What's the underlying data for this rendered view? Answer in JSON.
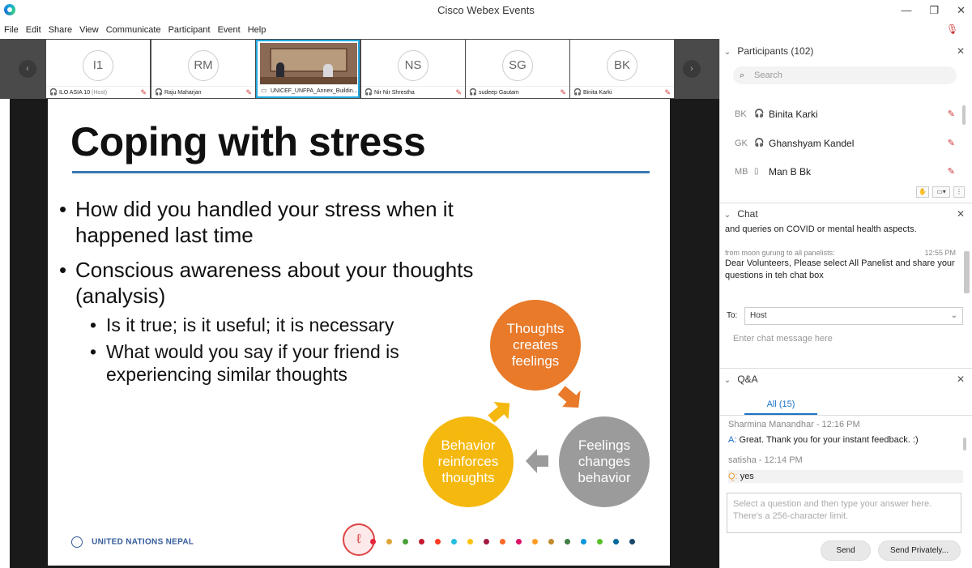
{
  "window": {
    "title": "Cisco Webex Events",
    "minimize": "—",
    "maximize": "❐",
    "close": "✕"
  },
  "menu": {
    "items": [
      "File",
      "Edit",
      "Share",
      "View",
      "Communicate",
      "Participant",
      "Event",
      "Help"
    ]
  },
  "strip": {
    "prev": "‹",
    "next": "›",
    "thumbs": [
      {
        "initials": "I1",
        "name": "ILO ASIA 10",
        "role": "(Host)"
      },
      {
        "initials": "RM",
        "name": "Raju Maharjan"
      },
      {
        "initials": "",
        "name": "UNICEF_UNFPA_Annex_Buildin..."
      },
      {
        "initials": "NS",
        "name": "Nir Nir Shrestha"
      },
      {
        "initials": "SG",
        "name": "sudeep Gautam"
      },
      {
        "initials": "BK",
        "name": "Binita Karki"
      }
    ]
  },
  "slide": {
    "title": "Coping with stress",
    "bullets": [
      {
        "lines": [
          "How did you handled your stress when it",
          "happened last time"
        ]
      },
      {
        "lines": [
          "Conscious awareness about your thoughts",
          "(analysis)"
        ]
      }
    ],
    "subbullets": [
      {
        "lines": [
          "Is it true; is it useful; it is necessary"
        ]
      },
      {
        "lines": [
          "What would you say if your friend is",
          "experiencing similar thoughts"
        ]
      }
    ],
    "cycle": {
      "thoughts": [
        "Thoughts",
        "creates",
        "feelings"
      ],
      "feelings": [
        "Feelings",
        "changes",
        "behavior"
      ],
      "behavior": [
        "Behavior",
        "reinforces",
        "thoughts"
      ]
    },
    "footer": "UNITED NATIONS NEPAL",
    "dot_colors": [
      "#e5243b",
      "#dda63a",
      "#4c9f38",
      "#c5192d",
      "#ff3a21",
      "#26bde2",
      "#fcc30b",
      "#a21942",
      "#fd6925",
      "#dd1367",
      "#fd9d24",
      "#bf8b2e",
      "#3f7e44",
      "#0a97d9",
      "#56c02b",
      "#00689d",
      "#19486a"
    ]
  },
  "participants": {
    "header": "Participants (102)",
    "search_placeholder": "Search",
    "list": [
      {
        "initials": "BK",
        "name": "Binita Karki",
        "device": "headset"
      },
      {
        "initials": "GK",
        "name": "Ghanshyam Kandel",
        "device": "headset"
      },
      {
        "initials": "MB",
        "name": "Man B Bk",
        "device": "phone"
      }
    ],
    "controls": [
      "✋",
      "▭▾",
      "⋮"
    ]
  },
  "chat": {
    "header": "Chat",
    "prev_line": "and queries on COVID or mental health aspects.",
    "msg_meta": "from moon gurung to all panelists:",
    "msg_time": "12:55 PM",
    "msg_lines": [
      "Dear Volunteers, Please select All Panelist and share your",
      "questions in teh chat box"
    ],
    "to_label": "To:",
    "to_value": "Host",
    "input_placeholder": "Enter chat message here"
  },
  "qa": {
    "header": "Q&A",
    "tab": "All (15)",
    "entries": [
      {
        "meta": "Sharmina Manandhar - 12:16 PM",
        "prefix": "A:",
        "text": "Great. Thank you for your instant feedback. :)"
      },
      {
        "meta": "satisha - 12:14 PM",
        "prefix": "Q:",
        "text": "yes"
      }
    ],
    "answer_placeholder": [
      "Select a question and then type your answer here.",
      "There's a 256-character limit."
    ],
    "send": "Send",
    "send_privately": "Send Privately..."
  }
}
